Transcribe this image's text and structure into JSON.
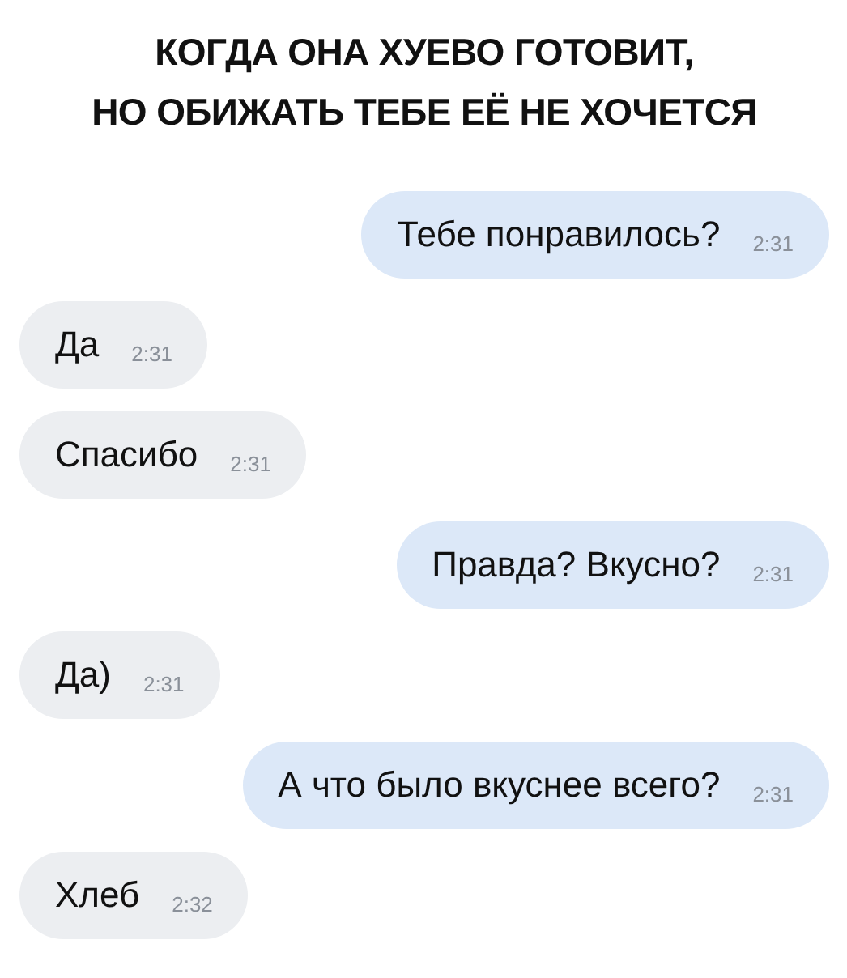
{
  "caption": [
    "КОГДА ОНА ХУЕВО ГОТОВИТ,",
    "НО ОБИЖАТЬ ТЕБЕ ЕЁ НЕ ХОЧЕТСЯ"
  ],
  "messages": [
    {
      "kind": "outgoing",
      "text": "Тебе понравилось?",
      "time": "2:31"
    },
    {
      "kind": "incoming",
      "text": "Да",
      "time": "2:31"
    },
    {
      "kind": "incoming",
      "text": "Спасибо",
      "time": "2:31"
    },
    {
      "kind": "outgoing",
      "text": "Правда? Вкусно?",
      "time": "2:31"
    },
    {
      "kind": "incoming",
      "text": "Да)",
      "time": "2:31"
    },
    {
      "kind": "outgoing",
      "text": "А что было вкуснее всего?",
      "time": "2:31"
    },
    {
      "kind": "incoming",
      "text": "Хлеб",
      "time": "2:32"
    }
  ]
}
